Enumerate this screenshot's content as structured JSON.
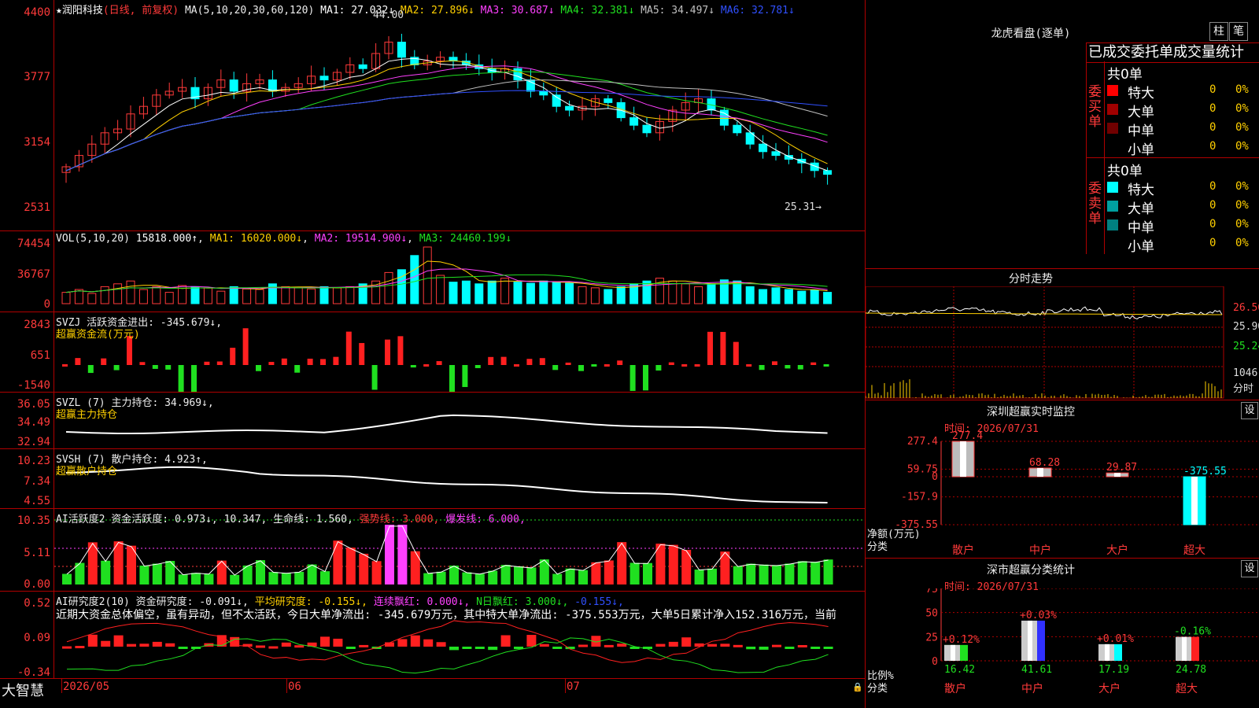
{
  "header": {
    "stock_name": "★润阳科技",
    "period": "(日线, 前复权)",
    "ma_group": "MA(5,10,20,30,60,120)",
    "mas": [
      {
        "label": "MA1:",
        "value": "27.032↓",
        "color": "#ffffff"
      },
      {
        "label": "MA2:",
        "value": "27.896↓",
        "color": "#ffd000"
      },
      {
        "label": "MA3:",
        "value": "30.687↓",
        "color": "#ff40ff"
      },
      {
        "label": "MA4:",
        "value": "32.381↓",
        "color": "#20e020"
      },
      {
        "label": "MA5:",
        "value": "34.497↓",
        "color": "#c0c0c0"
      },
      {
        "label": "MA6:",
        "value": "32.781↓",
        "color": "#3050ff"
      }
    ],
    "high_marker": "44.00",
    "low_marker": "25.31→"
  },
  "price_axis": [
    "4400",
    "3777",
    "3154",
    "2531"
  ],
  "vol": {
    "legend": "VOL(5,10,20)",
    "value": "15818.000↑",
    "ma1": "MA1: 16020.000↓",
    "ma2": "MA2: 19514.900↓",
    "ma3": "MA3: 24460.199↓",
    "axis": [
      "74454",
      "36767",
      "0"
    ]
  },
  "svzj": {
    "legend": "SVZJ  活跃资金进出: -345.679↓,",
    "sub": "超赢资金流(万元)",
    "axis": [
      "2843",
      "651",
      "-1540"
    ]
  },
  "svzl": {
    "legend": "SVZL (7) 主力持仓: 34.969↓,",
    "sub": "超赢主力持仓",
    "axis": [
      "36.05",
      "34.49",
      "32.94"
    ]
  },
  "svsh": {
    "legend": "SVSH (7) 散户持仓: 4.923↑,",
    "sub": "超赢散户持仓",
    "axis": [
      "10.23",
      "7.34",
      "4.55"
    ]
  },
  "ai1": {
    "legend_parts": [
      {
        "text": "AI活跃度2 资金活跃度: 0.973↓, 10.347, 生命线: 1.560, ",
        "color": "#eeeeee"
      },
      {
        "text": "强势线: 3.000, ",
        "color": "#ff3a3a"
      },
      {
        "text": "爆发线: 6.000,",
        "color": "#ff40ff"
      }
    ],
    "axis": [
      "10.35",
      "5.11",
      "0.00"
    ]
  },
  "ai2": {
    "legend_parts": [
      {
        "text": "AI研究度2(10) 资金研究度: -0.091↓, ",
        "color": "#eeeeee"
      },
      {
        "text": "平均研究度: -0.155↓, ",
        "color": "#ffd000"
      },
      {
        "text": "连续飘红: 0.000↓, ",
        "color": "#ff40ff"
      },
      {
        "text": "N日飘红: 3.000↓, ",
        "color": "#20e020"
      },
      {
        "text": "-0.155↓,",
        "color": "#3050ff"
      }
    ],
    "comment": "近期大资金总体偏空，虽有异动，但不太活跃，今日大单净流出: -345.679万元，其中特大单净流出: -375.553万元，大单5日累计净入152.316万元，当前",
    "axis": [
      "0.52",
      "0.09",
      "-0.34"
    ]
  },
  "bottom": {
    "brand": "大智慧",
    "dates": [
      "2026/05",
      "06",
      "07"
    ]
  },
  "dragon": {
    "title": "龙虎看盘(逐单)",
    "btn1": "柱",
    "btn2": "笔",
    "tabs": "已成交委托单成交量统计",
    "buy_label": "委买单",
    "sell_label": "委卖单",
    "buy_total": "共0单",
    "sell_total": "共0单",
    "buy_rows": [
      {
        "name": "特大",
        "count": "0",
        "pct": "0%",
        "color": "#ff0000"
      },
      {
        "name": "大单",
        "count": "0",
        "pct": "0%",
        "color": "#a00000"
      },
      {
        "name": "中单",
        "count": "0",
        "pct": "0%",
        "color": "#700000"
      },
      {
        "name": "小单",
        "count": "0",
        "pct": "0%",
        "color": ""
      }
    ],
    "sell_rows": [
      {
        "name": "特大",
        "count": "0",
        "pct": "0%",
        "color": "#00ffff"
      },
      {
        "name": "大单",
        "count": "0",
        "pct": "0%",
        "color": "#00a0a0"
      },
      {
        "name": "中单",
        "count": "0",
        "pct": "0%",
        "color": "#008080"
      },
      {
        "name": "小单",
        "count": "0",
        "pct": "0%",
        "color": ""
      }
    ]
  },
  "intraday": {
    "title": "分时走势",
    "axis": [
      "26.56",
      "25.90",
      "25.24"
    ],
    "vol_axis": [
      "1046",
      "分时"
    ]
  },
  "monitor": {
    "title": "深圳超赢实时监控",
    "set": "设",
    "time": "时间: 2026/07/31",
    "axis": [
      "277.4",
      "59.75",
      "0",
      "-157.9",
      "-375.55"
    ],
    "unit": "净额(万元)",
    "cat_label": "分类",
    "values": [
      {
        "cat": "散户",
        "value": 277.4,
        "label": "277.4"
      },
      {
        "cat": "中户",
        "value": 68.28,
        "label": "68.28"
      },
      {
        "cat": "大户",
        "value": 29.87,
        "label": "29.87"
      },
      {
        "cat": "超大",
        "value": -375.55,
        "label": "-375.55"
      }
    ]
  },
  "class_stats": {
    "title": "深市超赢分类统计",
    "set": "设",
    "time": "时间: 2026/07/31",
    "axis": [
      "75",
      "50",
      "25",
      "0"
    ],
    "unit": "比例%",
    "cat_label": "分类",
    "values": [
      {
        "cat": "散户",
        "value": 16.42,
        "label": "16.42",
        "chg": "+0.12%",
        "color": "#20e020"
      },
      {
        "cat": "中户",
        "value": 41.61,
        "label": "41.61",
        "chg": "+0.03%",
        "color": "#3030ff"
      },
      {
        "cat": "大户",
        "value": 17.19,
        "label": "17.19",
        "chg": "+0.01%",
        "color": "#00ffff"
      },
      {
        "cat": "超大",
        "value": 24.78,
        "label": "24.78",
        "chg": "-0.16%",
        "color": "#ff2020"
      }
    ]
  }
}
